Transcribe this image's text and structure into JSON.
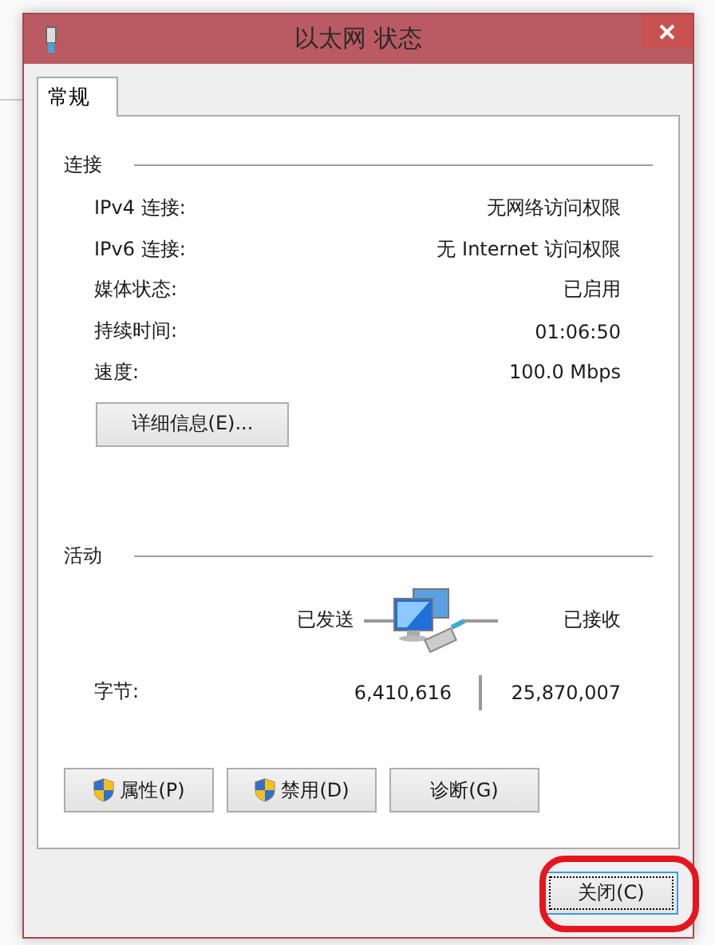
{
  "window": {
    "title": "以太网 状态"
  },
  "tabs": [
    {
      "label": "常规",
      "selected": true
    }
  ],
  "connection": {
    "heading": "连接",
    "rows": [
      {
        "label": "IPv4 连接:",
        "value": "无网络访问权限"
      },
      {
        "label": "IPv6 连接:",
        "value": "无 Internet 访问权限"
      },
      {
        "label": "媒体状态:",
        "value": "已启用"
      },
      {
        "label": "持续时间:",
        "value": "01:06:50"
      },
      {
        "label": "速度:",
        "value": "100.0 Mbps"
      }
    ],
    "details_button": "详细信息(E)..."
  },
  "activity": {
    "heading": "活动",
    "sent_label": "已发送",
    "received_label": "已接收",
    "bytes_label": "字节:",
    "sent": "6,410,616",
    "received": "25,870,007"
  },
  "actions": [
    {
      "label": "属性(P)",
      "shield": true
    },
    {
      "label": "禁用(D)",
      "shield": true
    },
    {
      "label": "诊断(G)",
      "shield": false
    }
  ],
  "close_button": {
    "label": "关闭(C)",
    "highlighted": true
  }
}
